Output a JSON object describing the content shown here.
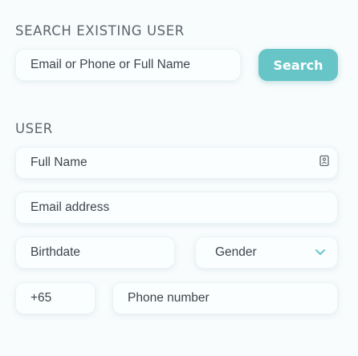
{
  "search": {
    "title": "SEARCH EXISTING USER",
    "placeholder": "Email or Phone or Full Name",
    "button_label": "Search"
  },
  "user": {
    "title": "USER",
    "full_name_placeholder": "Full Name",
    "email_placeholder": "Email address",
    "birthdate_placeholder": "Birthdate",
    "gender_selected": "Gender",
    "country_code": "+65",
    "phone_placeholder": "Phone number"
  },
  "icons": {
    "full_name_icon": "contact-card-icon",
    "gender_icon": "chevron-down-icon"
  },
  "colors": {
    "accent": "#67c5c7",
    "background": "#f9fcfd"
  }
}
